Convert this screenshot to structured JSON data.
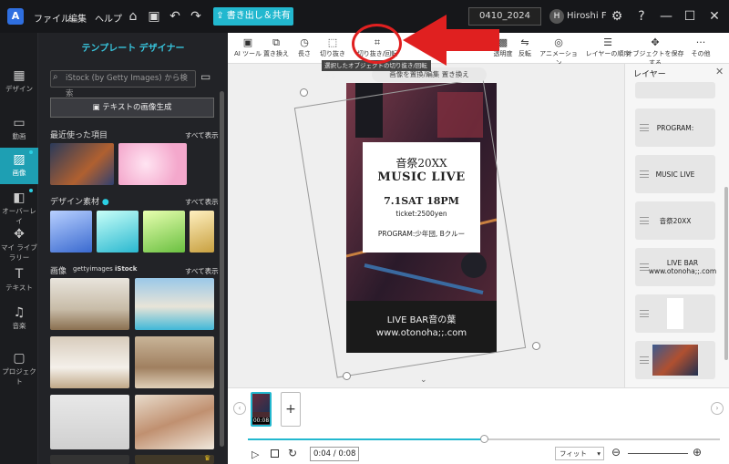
{
  "titlebar": {
    "logo": "A",
    "menus": [
      "ファイル",
      "編集",
      "ヘルプ"
    ],
    "export_label": "書き出し＆共有",
    "export_icon": "upload-icon",
    "project_name": "0410_2024",
    "avatar_initial": "H",
    "user_name": "Hiroshi F"
  },
  "panel": {
    "title": "テンプレート デザイナー",
    "search_placeholder": "iStock (by Getty Images) から検索",
    "generate_label": "テキストの画像生成",
    "recent_title": "最近使った項目",
    "design_title": "デザイン素材",
    "images_title": "画像",
    "getty_label": "gettyimages",
    "istock_label": "iStock",
    "see_all": "すべて表示"
  },
  "rail": [
    {
      "label": "デザイン",
      "icon": "design-icon"
    },
    {
      "label": "動画",
      "icon": "video-icon"
    },
    {
      "label": "画像",
      "icon": "image-icon"
    },
    {
      "label": "オーバーレイ",
      "icon": "overlay-icon"
    },
    {
      "label": "マイ ライブラリー",
      "icon": "library-icon"
    },
    {
      "label": "テキスト",
      "icon": "text-icon"
    },
    {
      "label": "音楽",
      "icon": "music-icon"
    },
    {
      "label": "プロジェクト",
      "icon": "project-icon"
    }
  ],
  "toolbar": {
    "tools": [
      "AI ツール",
      "置き換え",
      "長さ",
      "切り抜き",
      "切り抜き/回転",
      "透明度",
      "反転",
      "アニメーション",
      "レイヤーの順序",
      "オブジェクトを保存する",
      "その他"
    ],
    "tooltip": "選択したオブジェクトの切り抜き/回転する",
    "replace_bar": "画像を置換/編集  置き換え"
  },
  "poster": {
    "title_jp": "音祭20XX",
    "title_en": "MUSIC LIVE",
    "date": "7.1SAT 18PM",
    "ticket": "ticket:2500yen",
    "program": "PROGRAM:少年団, Bクルー",
    "venue": "LIVE BAR音の葉",
    "url": "www.otonoha;;.com"
  },
  "layers": {
    "title": "レイヤー",
    "items": [
      "PROGRAM:",
      "MUSIC LIVE",
      "音祭20XX",
      "LIVE BAR www.otonoha;;.com"
    ]
  },
  "timeline": {
    "clip_time": "00:08",
    "current_time": "0:04 / 0:08",
    "fit_label": "フィット",
    "progress": 0.5
  },
  "colors": {
    "accent": "#22b8cf",
    "annotation": "#e02020",
    "rail_active": "#1e9fb3"
  }
}
